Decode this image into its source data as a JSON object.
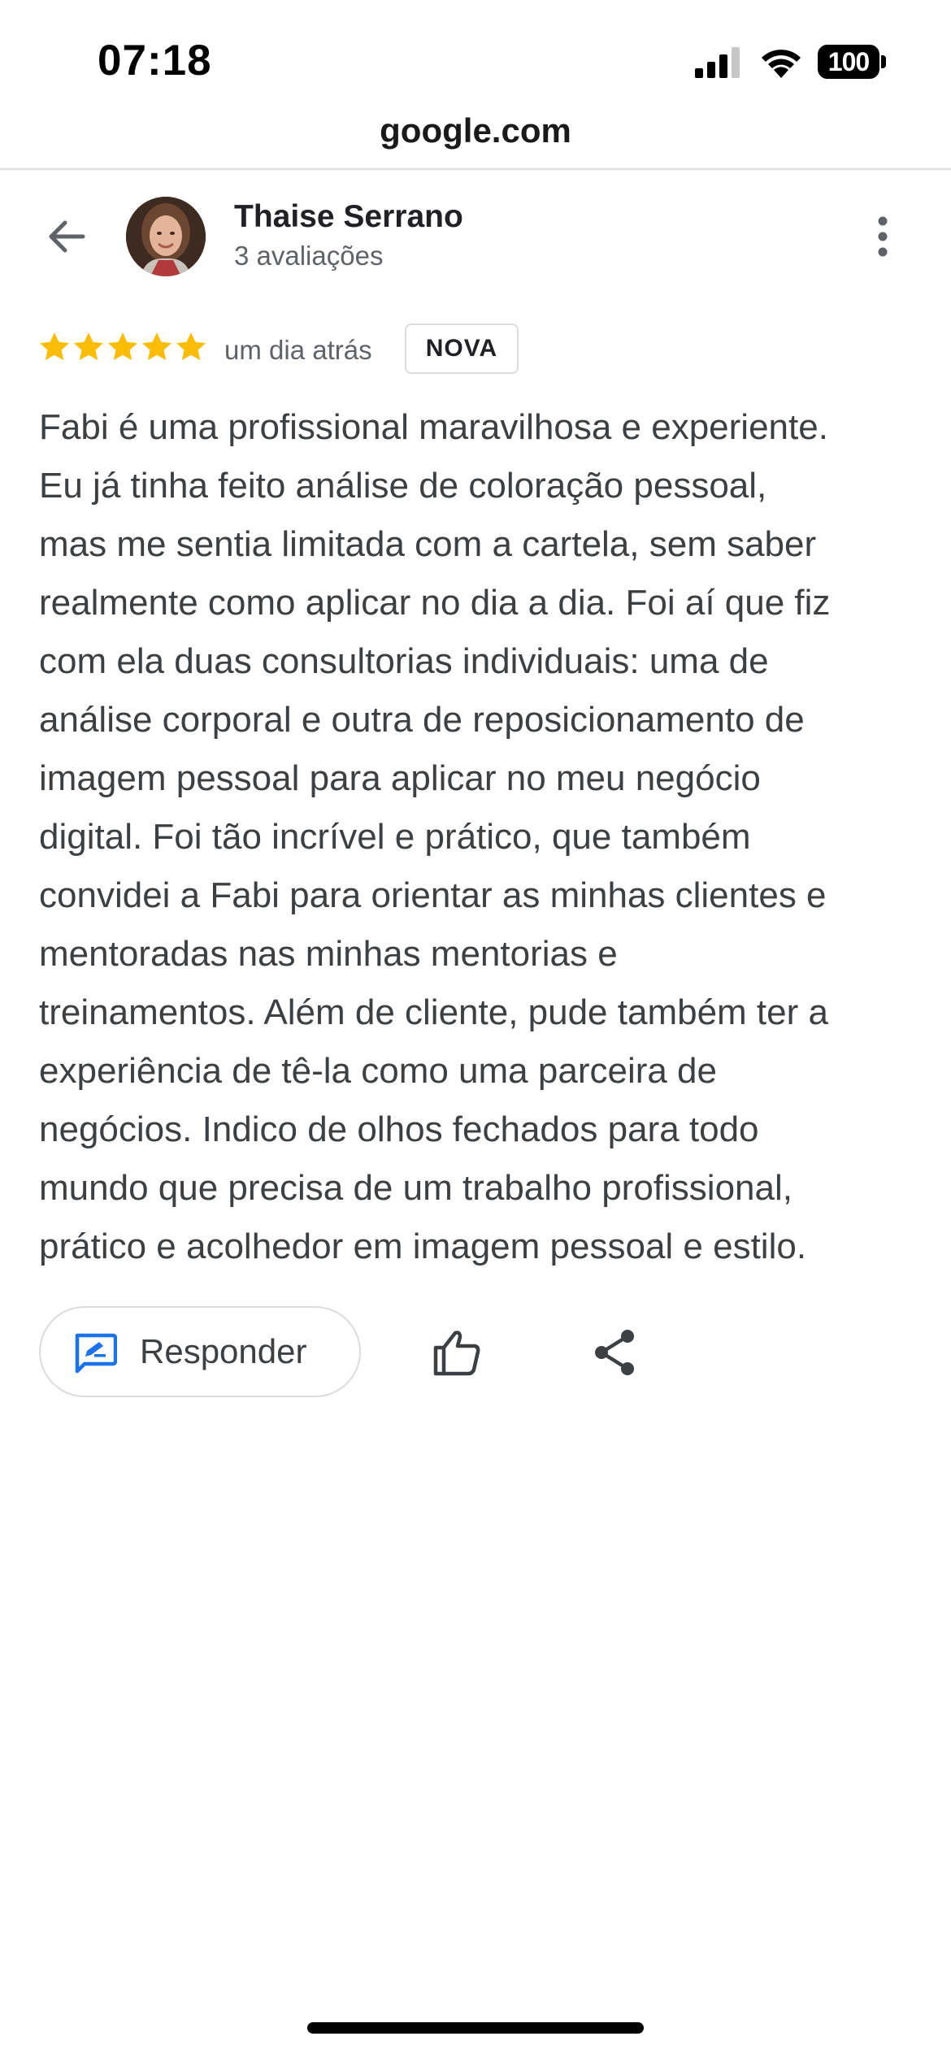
{
  "status_bar": {
    "time": "07:18",
    "battery": "100",
    "icons": [
      "signal-icon",
      "wifi-icon",
      "battery-icon"
    ]
  },
  "browser": {
    "url": "google.com"
  },
  "header": {
    "back_icon": "arrow-left-icon",
    "reviewer_name": "Thaise Serrano",
    "reviewer_reviews": "3 avaliações",
    "more_icon": "more-vert-icon"
  },
  "review": {
    "rating": 5,
    "rating_max": 5,
    "date": "um dia atrás",
    "badge": "NOVA",
    "text_lines": [
      "Fabi é uma profissional maravilhosa e experiente.",
      "Eu já tinha feito análise de coloração pessoal,",
      "mas me sentia limitada com a cartela, sem saber",
      "realmente como aplicar no dia a dia. Foi aí que fiz",
      "com ela duas consultorias individuais: uma de",
      "análise corporal e outra de reposicionamento de",
      "imagem pessoal para aplicar no meu negócio",
      "digital. Foi tão incrível e prático, que também",
      "convidei a Fabi para orientar as minhas clientes e",
      "mentoradas nas minhas mentorias e",
      "treinamentos. Além de cliente, pude também ter a",
      "experiência de tê-la como uma parceira de",
      "negócios. Indico de olhos fechados para todo",
      "mundo que precisa de um trabalho profissional,",
      "prático e acolhedor em imagem pessoal e estilo."
    ]
  },
  "actions": {
    "reply_label": "Responder",
    "reply_icon": "rate-review-icon",
    "like_icon": "thumb-up-icon",
    "share_icon": "share-icon"
  },
  "colors": {
    "star": "#FBBC04",
    "accent_blue": "#1A73E8",
    "text_primary": "#202124",
    "text_secondary": "#5F6368",
    "body_text": "#3C4043",
    "border": "#DADCE0"
  }
}
